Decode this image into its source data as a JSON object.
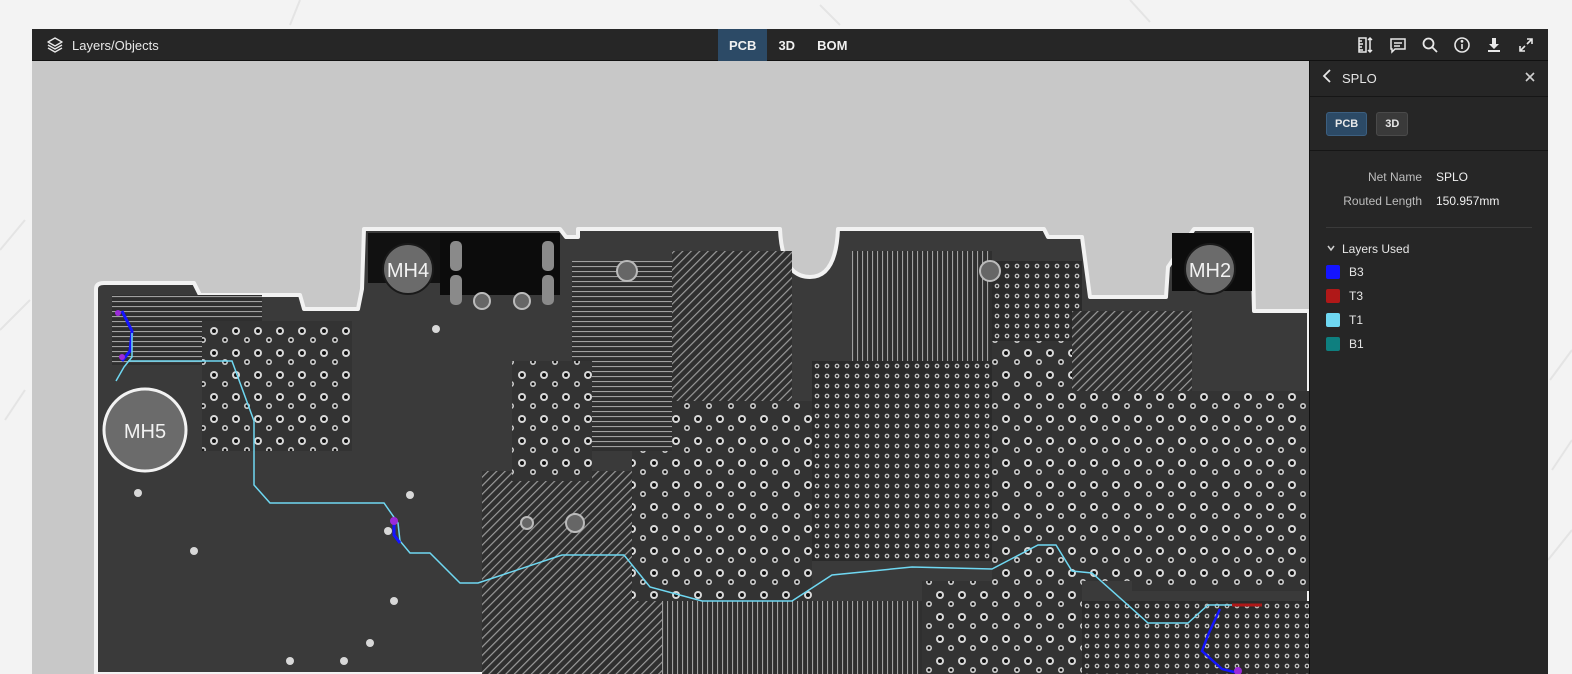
{
  "topbar": {
    "panel_label": "Layers/Objects",
    "tabs": [
      {
        "label": "PCB",
        "active": true
      },
      {
        "label": "3D",
        "active": false
      },
      {
        "label": "BOM",
        "active": false
      }
    ],
    "right_icons": [
      "measure-icon",
      "comment-icon",
      "search-icon",
      "info-icon",
      "download-icon",
      "fullscreen-icon"
    ]
  },
  "board": {
    "mounting_holes": [
      "MH4",
      "MH2",
      "MH5"
    ]
  },
  "panel": {
    "title": "SPLO",
    "view_buttons": [
      {
        "label": "PCB",
        "active": true
      },
      {
        "label": "3D",
        "active": false
      }
    ],
    "properties": [
      {
        "key": "Net Name",
        "value": "SPLO"
      },
      {
        "key": "Routed Length",
        "value": "150.957mm"
      }
    ],
    "layers_heading": "Layers Used",
    "layers": [
      {
        "name": "B3",
        "color": "#1414ff"
      },
      {
        "name": "T3",
        "color": "#b01818"
      },
      {
        "name": "T1",
        "color": "#6fd8f2"
      },
      {
        "name": "B1",
        "color": "#0e7f7f"
      }
    ]
  },
  "colors": {
    "accent": "#2c4a66",
    "board": "#3a3a3a",
    "canvas": "#c8c8c8",
    "trace_highlight": "#6fd8f2"
  }
}
